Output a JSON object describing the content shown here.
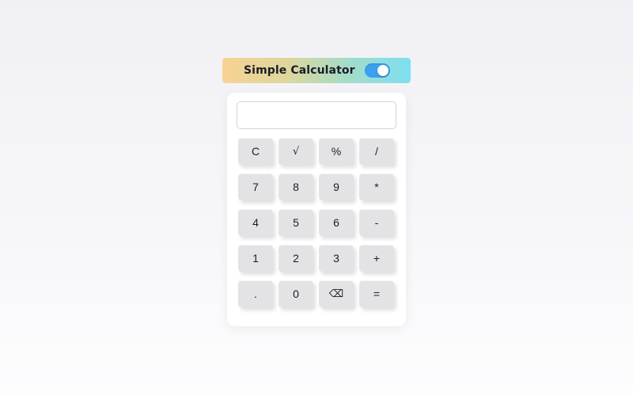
{
  "header": {
    "title": "Simple Calculator",
    "toggle_state": "on",
    "toggle_color": "#3d9ff0"
  },
  "display": {
    "value": "",
    "placeholder": ""
  },
  "keys": [
    {
      "label": "C",
      "name": "clear-button"
    },
    {
      "label": "√",
      "name": "sqrt-button"
    },
    {
      "label": "%",
      "name": "percent-button"
    },
    {
      "label": "/",
      "name": "divide-button"
    },
    {
      "label": "7",
      "name": "digit-7-button"
    },
    {
      "label": "8",
      "name": "digit-8-button"
    },
    {
      "label": "9",
      "name": "digit-9-button"
    },
    {
      "label": "*",
      "name": "multiply-button"
    },
    {
      "label": "4",
      "name": "digit-4-button"
    },
    {
      "label": "5",
      "name": "digit-5-button"
    },
    {
      "label": "6",
      "name": "digit-6-button"
    },
    {
      "label": "-",
      "name": "subtract-button"
    },
    {
      "label": "1",
      "name": "digit-1-button"
    },
    {
      "label": "2",
      "name": "digit-2-button"
    },
    {
      "label": "3",
      "name": "digit-3-button"
    },
    {
      "label": "+",
      "name": "add-button"
    },
    {
      "label": ".",
      "name": "decimal-button"
    },
    {
      "label": "0",
      "name": "digit-0-button"
    },
    {
      "label": "⌫",
      "name": "backspace-button"
    },
    {
      "label": "=",
      "name": "equals-button"
    }
  ]
}
